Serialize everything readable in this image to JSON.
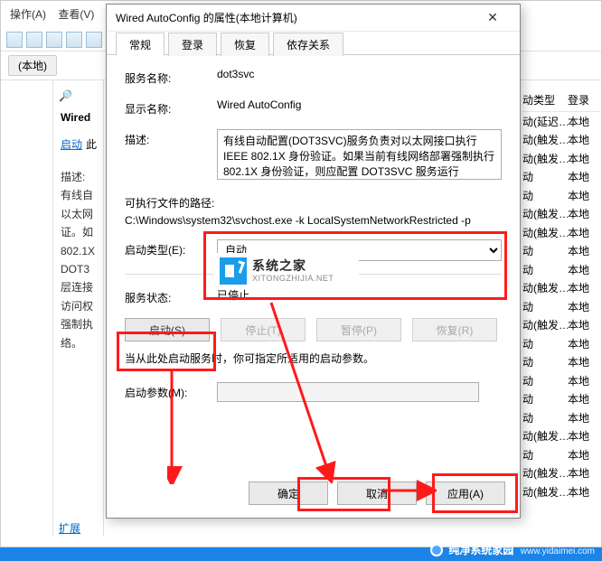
{
  "ie": {
    "menu": {
      "action": "操作(A)",
      "view": "查看(V)"
    },
    "addr": "(本地)",
    "left": {
      "header": "Wired",
      "link": "启动",
      "descLabel": "描述:",
      "desc": "有线自\n以太网\n证。如\n802.1X\nDOT3\n层连接\n访问权\n强制执\n络。"
    },
    "expandLabel": "扩展",
    "mag": "🔎"
  },
  "rightList": {
    "head": {
      "c1": "动类型",
      "c2": "登录"
    },
    "rows": [
      {
        "c1": "动(延迟…",
        "c2": "本地"
      },
      {
        "c1": "动(触发…",
        "c2": "本地"
      },
      {
        "c1": "动(触发…",
        "c2": "本地"
      },
      {
        "c1": "动",
        "c2": "本地"
      },
      {
        "c1": "动",
        "c2": "本地"
      },
      {
        "c1": "动(触发…",
        "c2": "本地"
      },
      {
        "c1": "动(触发…",
        "c2": "本地"
      },
      {
        "c1": "动",
        "c2": "本地"
      },
      {
        "c1": "动",
        "c2": "本地"
      },
      {
        "c1": "动(触发…",
        "c2": "本地"
      },
      {
        "c1": "动",
        "c2": "本地"
      },
      {
        "c1": "动(触发…",
        "c2": "本地"
      },
      {
        "c1": "动",
        "c2": "本地"
      },
      {
        "c1": "动",
        "c2": "本地"
      },
      {
        "c1": "动",
        "c2": "本地"
      },
      {
        "c1": "动",
        "c2": "本地"
      },
      {
        "c1": "动",
        "c2": "本地"
      },
      {
        "c1": "动(触发…",
        "c2": "本地"
      },
      {
        "c1": "动",
        "c2": "本地"
      },
      {
        "c1": "动(触发…",
        "c2": "本地"
      },
      {
        "c1": "动(触发…",
        "c2": "本地"
      }
    ]
  },
  "dlg": {
    "title": "Wired AutoConfig 的属性(本地计算机)",
    "close": "✕",
    "tabs": {
      "general": "常规",
      "logon": "登录",
      "recovery": "恢复",
      "deps": "依存关系"
    },
    "labels": {
      "serviceName": "服务名称:",
      "displayName": "显示名称:",
      "description": "描述:",
      "exePath": "可执行文件的路径:",
      "startupType": "启动类型(E):",
      "serviceStatus": "服务状态:",
      "startParam": "启动参数(M):"
    },
    "values": {
      "serviceName": "dot3svc",
      "displayName": "Wired AutoConfig",
      "description": "有线自动配置(DOT3SVC)服务负责对以太网接口执行 IEEE 802.1X 身份验证。如果当前有线网络部署强制执行 802.1X 身份验证，则应配置 DOT3SVC 服务运行",
      "exePath": "C:\\Windows\\system32\\svchost.exe -k LocalSystemNetworkRestricted -p",
      "startupType": "自动",
      "serviceStatus": "已停止",
      "startParam": ""
    },
    "buttons": {
      "start": "启动(S)",
      "stop": "停止(T)",
      "pause": "暂停(P)",
      "resume": "恢复(R)",
      "ok": "确定",
      "cancel": "取消",
      "apply": "应用(A)"
    },
    "hint": "当从此处启动服务时，你可指定所适用的启动参数。"
  },
  "watermark": {
    "big": "系统之家",
    "small": "XITONGZHIJIA.NET"
  },
  "footerWatermark": {
    "text": "纯净系统家园",
    "url": "www.yidaimei.com"
  }
}
